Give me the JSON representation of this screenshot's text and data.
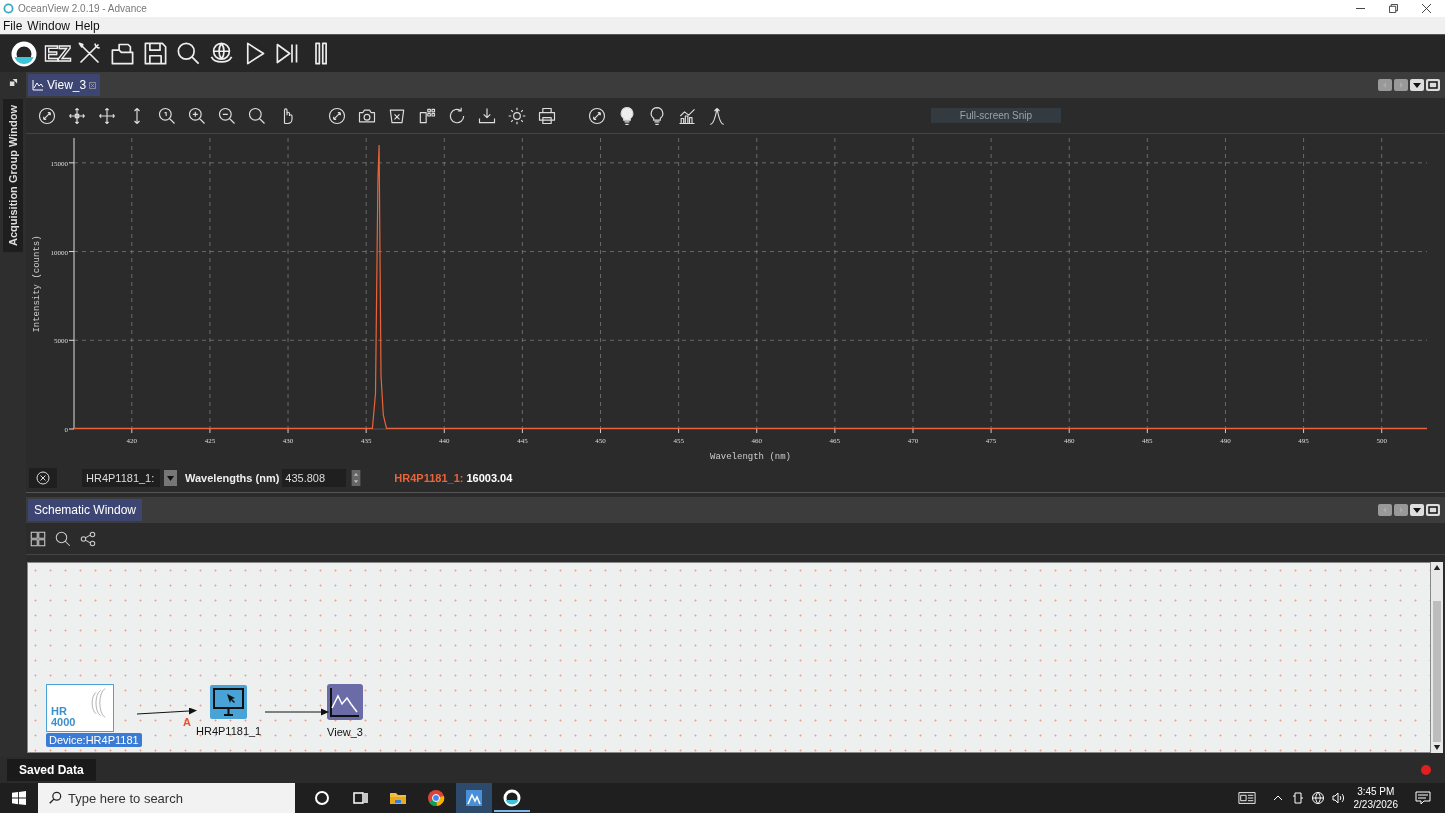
{
  "window": {
    "title": "OceanView 2.0.19  - Advance"
  },
  "menu": [
    {
      "label": "File"
    },
    {
      "label": "Window"
    },
    {
      "label": "Help"
    }
  ],
  "toolbar": {
    "ez_label": "EZ"
  },
  "side_tab": {
    "label": "Acquisition Group Window"
  },
  "view": {
    "tab": {
      "label": "View_3",
      "selected": true
    },
    "snip_label": "Full-screen Snip",
    "chart_data": {
      "type": "line",
      "grid": true,
      "xlabel": "Wavelength (nm)",
      "ylabel": "Intensity (counts)",
      "xlim": [
        416.3,
        502.9
      ],
      "ylim": [
        0,
        16400
      ],
      "xticks": [
        420,
        425,
        430,
        435,
        440,
        445,
        450,
        455,
        460,
        465,
        470,
        475,
        480,
        485,
        490,
        495,
        500
      ],
      "yticks": [
        0,
        5000,
        10000,
        15000
      ],
      "x": [
        416.3,
        435.4,
        435.6,
        435.75,
        435.83,
        435.95,
        436.1,
        436.3,
        502.9
      ],
      "series": [
        {
          "color": "#e8643a",
          "values": [
            40,
            40,
            2000,
            14000,
            16000,
            3000,
            800,
            40,
            40
          ]
        }
      ]
    },
    "readout": {
      "device": "HR4P1181_1:",
      "wavelength_label": "Wavelengths (nm)",
      "wavelength_value": "435.808",
      "series_label": "HR4P1181_1:",
      "series_value": "16003.04"
    }
  },
  "schematic": {
    "tab": {
      "label": "Schematic Window",
      "selected": true
    },
    "nodes": [
      {
        "kind": "device",
        "lines": [
          "HR",
          "4000"
        ],
        "caption": "Device:HR4P1181"
      },
      {
        "kind": "processor",
        "caption": "HR4P1181_1"
      },
      {
        "kind": "view",
        "caption": "View_3"
      }
    ],
    "port_label": "A"
  },
  "status": {
    "tab": "Saved Data"
  },
  "taskbar": {
    "search_placeholder": "Type here to search",
    "time": "3:45 PM",
    "date": "2/23/2026"
  }
}
